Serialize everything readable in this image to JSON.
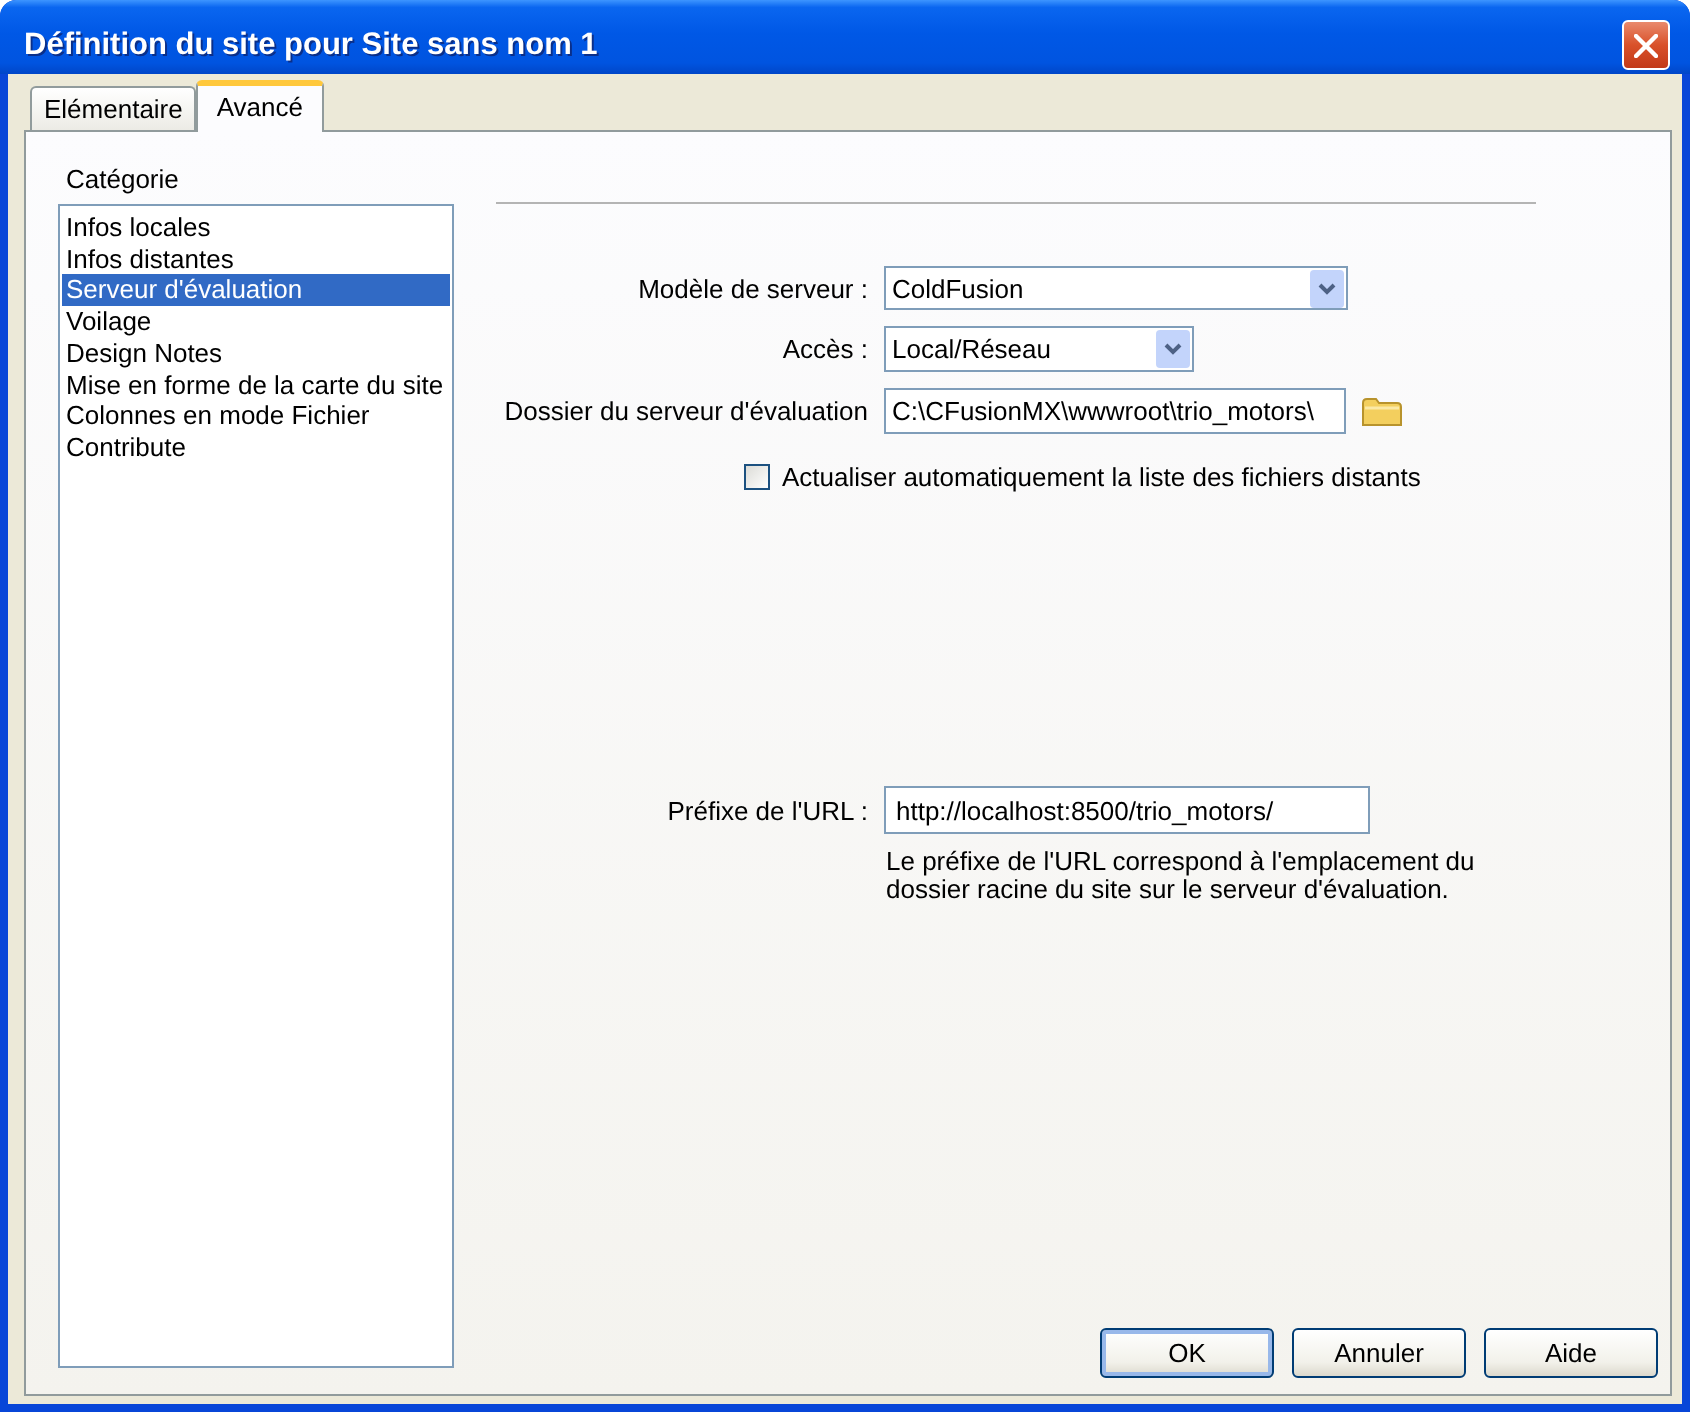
{
  "window": {
    "title": "Définition du site pour Site sans nom 1"
  },
  "tabs": [
    {
      "label": "Elémentaire",
      "selected": false
    },
    {
      "label": "Avancé",
      "selected": true
    }
  ],
  "category": {
    "label": "Catégorie",
    "items": [
      {
        "label": "Infos locales",
        "selected": false
      },
      {
        "label": "Infos distantes",
        "selected": false
      },
      {
        "label": "Serveur d'évaluation",
        "selected": true
      },
      {
        "label": "Voilage",
        "selected": false
      },
      {
        "label": "Design Notes",
        "selected": false
      },
      {
        "label": "Mise en forme de la carte du site",
        "selected": false
      },
      {
        "label": "Colonnes en mode Fichier",
        "selected": false
      },
      {
        "label": "Contribute",
        "selected": false
      }
    ]
  },
  "form": {
    "server_model": {
      "label": "Modèle de serveur :",
      "value": "ColdFusion"
    },
    "access": {
      "label": "Accès :",
      "value": "Local/Réseau"
    },
    "test_folder": {
      "label": "Dossier du serveur d'évaluation",
      "value": "C:\\CFusionMX\\wwwroot\\trio_motors\\"
    },
    "auto_refresh": {
      "label": "Actualiser automatiquement la liste des fichiers distants",
      "checked": false
    },
    "url_prefix": {
      "label": "Préfixe de l'URL :",
      "value": "http://localhost:8500/trio_motors/",
      "help": "Le préfixe de l'URL correspond à l'emplacement du dossier racine du site sur le serveur d'évaluation."
    }
  },
  "buttons": [
    {
      "label": "OK",
      "default": true
    },
    {
      "label": "Annuler",
      "default": false
    },
    {
      "label": "Aide",
      "default": false
    }
  ]
}
